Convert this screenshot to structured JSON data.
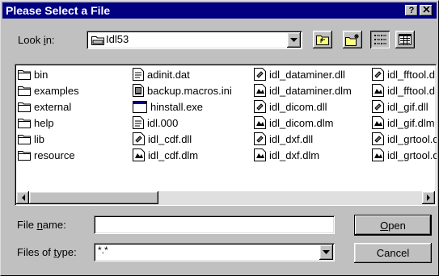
{
  "title": "Please Select a File",
  "title_buttons": {
    "help": "?",
    "close": "X"
  },
  "look_in": {
    "label_pre": "Look ",
    "label_u": "i",
    "label_post": "n:",
    "value": "Idl53"
  },
  "toolbar_icons": [
    "up-folder-icon",
    "new-folder-icon",
    "list-view-icon",
    "details-view-icon"
  ],
  "files": [
    {
      "name": "bin",
      "icon": "folder-icon"
    },
    {
      "name": "examples",
      "icon": "folder-icon"
    },
    {
      "name": "external",
      "icon": "folder-icon"
    },
    {
      "name": "help",
      "icon": "folder-icon"
    },
    {
      "name": "lib",
      "icon": "folder-icon"
    },
    {
      "name": "resource",
      "icon": "folder-icon"
    },
    {
      "name": "adinit.dat",
      "icon": "file-icon"
    },
    {
      "name": "backup.macros.ini",
      "icon": "ini-file-icon"
    },
    {
      "name": "hinstall.exe",
      "icon": "exe-icon"
    },
    {
      "name": "idl.000",
      "icon": "file-icon"
    },
    {
      "name": "idl_cdf.dll",
      "icon": "dll-icon"
    },
    {
      "name": "idl_cdf.dlm",
      "icon": "dlm-icon"
    },
    {
      "name": "idl_dataminer.dll",
      "icon": "dll-icon"
    },
    {
      "name": "idl_dataminer.dlm",
      "icon": "dlm-icon"
    },
    {
      "name": "idl_dicom.dll",
      "icon": "dll-icon"
    },
    {
      "name": "idl_dicom.dlm",
      "icon": "dlm-icon"
    },
    {
      "name": "idl_dxf.dll",
      "icon": "dll-icon"
    },
    {
      "name": "idl_dxf.dlm",
      "icon": "dlm-icon"
    },
    {
      "name": "idl_fftool.d",
      "icon": "dll-icon"
    },
    {
      "name": "idl_fftool.d",
      "icon": "dlm-icon"
    },
    {
      "name": "idl_gif.dll",
      "icon": "dll-icon"
    },
    {
      "name": "idl_gif.dlm",
      "icon": "dlm-icon"
    },
    {
      "name": "idl_grtool.d",
      "icon": "dll-icon"
    },
    {
      "name": "idl_grtool.d",
      "icon": "dlm-icon"
    }
  ],
  "file_name": {
    "label_pre": "File ",
    "label_u": "n",
    "label_post": "ame:",
    "value": ""
  },
  "file_type": {
    "label_pre": "Files of ",
    "label_u": "t",
    "label_post": "ype:",
    "value": "*.*"
  },
  "buttons": {
    "open_u": "O",
    "open_rest": "pen",
    "cancel": "Cancel"
  }
}
